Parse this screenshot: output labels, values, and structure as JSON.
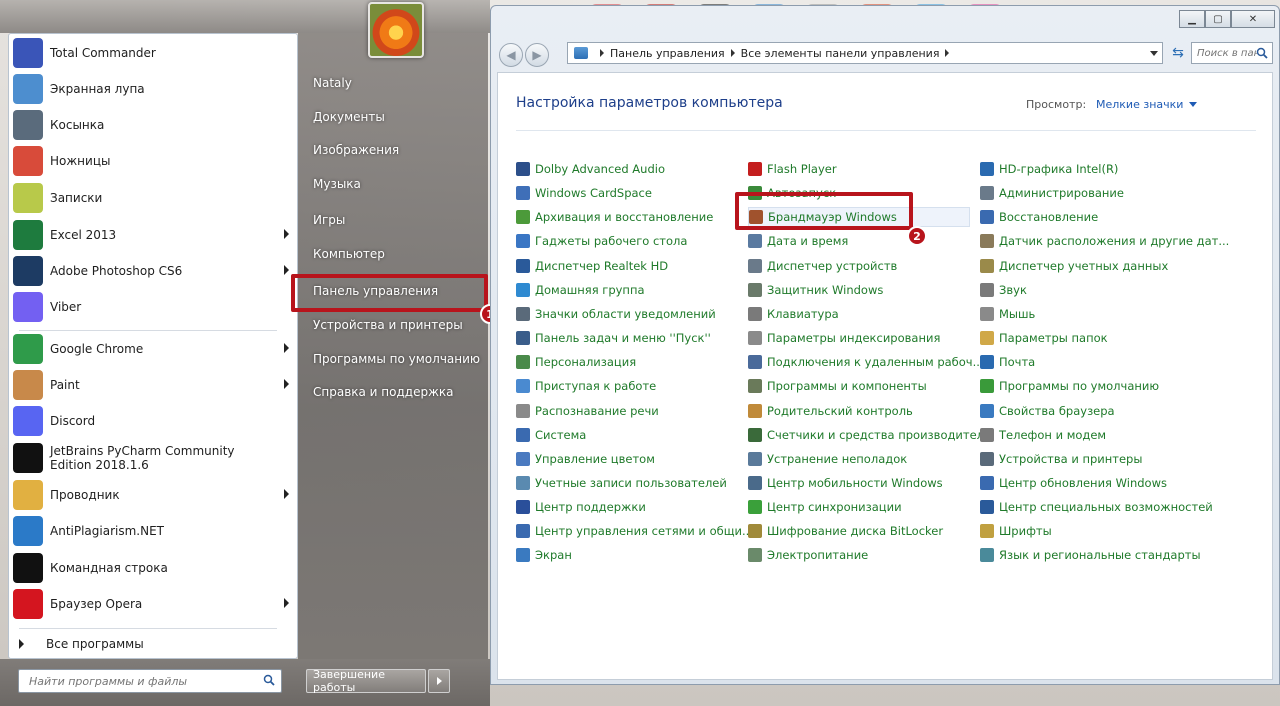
{
  "start_menu": {
    "programs": [
      {
        "label": "Total Commander",
        "icon": "total-commander-icon",
        "color": "#3a55b8",
        "arrow": false
      },
      {
        "label": "Экранная лупа",
        "icon": "magnifier-icon",
        "color": "#4d8ecf",
        "arrow": false
      },
      {
        "label": "Косынка",
        "icon": "solitaire-icon",
        "color": "#5a6b7c",
        "arrow": false
      },
      {
        "label": "Ножницы",
        "icon": "scissors-icon",
        "color": "#d84b3a",
        "arrow": false
      },
      {
        "label": "Записки",
        "icon": "sticky-notes-icon",
        "color": "#b8c94a",
        "arrow": false
      },
      {
        "label": "Excel 2013",
        "icon": "excel-icon",
        "color": "#1e7b3e",
        "arrow": true
      },
      {
        "label": "Adobe Photoshop CS6",
        "icon": "photoshop-icon",
        "color": "#1d3b63",
        "arrow": true
      },
      {
        "label": "Viber",
        "icon": "viber-icon",
        "color": "#7360f2",
        "arrow": false
      },
      {
        "label": "Google Chrome",
        "icon": "chrome-icon",
        "color": "#2f9b4a",
        "arrow": true
      },
      {
        "label": "Paint",
        "icon": "paint-icon",
        "color": "#c8894a",
        "arrow": true
      },
      {
        "label": "Discord",
        "icon": "discord-icon",
        "color": "#5865f2",
        "arrow": false
      },
      {
        "label": "JetBrains PyCharm Community Edition 2018.1.6",
        "icon": "pycharm-icon",
        "color": "#111111",
        "arrow": false
      },
      {
        "label": "Проводник",
        "icon": "explorer-icon",
        "color": "#e1b041",
        "arrow": true
      },
      {
        "label": "AntiPlagiarism.NET",
        "icon": "antiplagiarism-icon",
        "color": "#2b7ac8",
        "arrow": false
      },
      {
        "label": "Командная строка",
        "icon": "cmd-icon",
        "color": "#111111",
        "arrow": false
      },
      {
        "label": "Браузер Opera",
        "icon": "opera-icon",
        "color": "#d4151f",
        "arrow": true
      }
    ],
    "all_programs": "Все программы",
    "search_placeholder": "Найти программы и файлы",
    "right_items": [
      {
        "label": "Nataly",
        "name": "user-name"
      },
      {
        "label": "Документы",
        "name": "documents"
      },
      {
        "label": "Изображения",
        "name": "pictures"
      },
      {
        "label": "Музыка",
        "name": "music"
      },
      {
        "label": "Игры",
        "name": "games"
      },
      {
        "label": "Компьютер",
        "name": "computer"
      },
      {
        "label": "Панель управления",
        "name": "control-panel"
      },
      {
        "label": "Устройства и принтеры",
        "name": "devices-printers"
      },
      {
        "label": "Программы по умолчанию",
        "name": "default-programs"
      },
      {
        "label": "Справка и поддержка",
        "name": "help-support"
      }
    ],
    "shutdown_label": "Завершение работы"
  },
  "annotations": {
    "step1": "1",
    "step2": "2",
    "highlight_color": "#b8141c"
  },
  "control_panel": {
    "breadcrumbs": [
      "Панель управления",
      "Все элементы панели управления"
    ],
    "search_placeholder": "Поиск в панели...",
    "heading": "Настройка параметров компьютера",
    "view_label": "Просмотр:",
    "view_value": "Мелкие значки",
    "columns": [
      [
        {
          "label": "Dolby Advanced Audio",
          "icon": "dolby-icon",
          "color": "#2c4f8a"
        },
        {
          "label": "Windows CardSpace",
          "icon": "cardspace-icon",
          "color": "#3f6fb8"
        },
        {
          "label": "Архивация и восстановление",
          "icon": "backup-icon",
          "color": "#4c9a3a"
        },
        {
          "label": "Гаджеты рабочего стола",
          "icon": "gadgets-icon",
          "color": "#3a76c4"
        },
        {
          "label": "Диспетчер Realtek HD",
          "icon": "realtek-icon",
          "color": "#2a5a9a"
        },
        {
          "label": "Домашняя группа",
          "icon": "homegroup-icon",
          "color": "#2f8ad1"
        },
        {
          "label": "Значки области уведомлений",
          "icon": "notification-icon",
          "color": "#5a6a7a"
        },
        {
          "label": "Панель задач и меню ''Пуск''",
          "icon": "taskbar-icon",
          "color": "#3a5d8a"
        },
        {
          "label": "Персонализация",
          "icon": "personalization-icon",
          "color": "#4a8a4a"
        },
        {
          "label": "Приступая к работе",
          "icon": "getting-started-icon",
          "color": "#4a8ad0"
        },
        {
          "label": "Распознавание речи",
          "icon": "speech-icon",
          "color": "#8a8a8a"
        },
        {
          "label": "Система",
          "icon": "system-icon",
          "color": "#3a6ab0"
        },
        {
          "label": "Управление цветом",
          "icon": "color-mgmt-icon",
          "color": "#4a7ac0"
        },
        {
          "label": "Учетные записи пользователей",
          "icon": "user-accounts-icon",
          "color": "#5a8ab0"
        },
        {
          "label": "Центр поддержки",
          "icon": "action-center-icon",
          "color": "#2a4f9a"
        },
        {
          "label": "Центр управления сетями и общи...",
          "icon": "network-icon",
          "color": "#3a6ab0"
        },
        {
          "label": "Экран",
          "icon": "display-icon",
          "color": "#3a7ac0"
        }
      ],
      [
        {
          "label": "Flash Player",
          "icon": "flash-icon",
          "color": "#c41e1e"
        },
        {
          "label": "Автозапуск",
          "icon": "autoplay-icon",
          "color": "#3a8a3a"
        },
        {
          "label": "Брандмауэр Windows",
          "icon": "firewall-icon",
          "color": "#a0522d"
        },
        {
          "label": "Дата и время",
          "icon": "datetime-icon",
          "color": "#5a7aa0"
        },
        {
          "label": "Диспетчер устройств",
          "icon": "device-manager-icon",
          "color": "#6a7a8a"
        },
        {
          "label": "Защитник Windows",
          "icon": "defender-icon",
          "color": "#6a7a6a"
        },
        {
          "label": "Клавиатура",
          "icon": "keyboard-icon",
          "color": "#7a7a7a"
        },
        {
          "label": "Параметры индексирования",
          "icon": "indexing-icon",
          "color": "#8a8a8a"
        },
        {
          "label": "Подключения к удаленным рабоч...",
          "icon": "remote-desktop-icon",
          "color": "#4a6a9a"
        },
        {
          "label": "Программы и компоненты",
          "icon": "programs-features-icon",
          "color": "#6a7a5a"
        },
        {
          "label": "Родительский контроль",
          "icon": "parental-control-icon",
          "color": "#c08a3a"
        },
        {
          "label": "Счетчики и средства производител...",
          "icon": "performance-icon",
          "color": "#3a6a3a"
        },
        {
          "label": "Устранение неполадок",
          "icon": "troubleshooting-icon",
          "color": "#5a7a9a"
        },
        {
          "label": "Центр мобильности Windows",
          "icon": "mobility-icon",
          "color": "#4a6a8a"
        },
        {
          "label": "Центр синхронизации",
          "icon": "sync-icon",
          "color": "#3aa03a"
        },
        {
          "label": "Шифрование диска BitLocker",
          "icon": "bitlocker-icon",
          "color": "#a08a3a"
        },
        {
          "label": "Электропитание",
          "icon": "power-icon",
          "color": "#6a8a6a"
        }
      ],
      [
        {
          "label": "HD-графика Intel(R)",
          "icon": "intel-graphics-icon",
          "color": "#2a6ab0"
        },
        {
          "label": "Администрирование",
          "icon": "admin-tools-icon",
          "color": "#6a7a8a"
        },
        {
          "label": "Восстановление",
          "icon": "recovery-icon",
          "color": "#3a6ab0"
        },
        {
          "label": "Датчик расположения и другие дат...",
          "icon": "location-sensor-icon",
          "color": "#8a7a5a"
        },
        {
          "label": "Диспетчер учетных данных",
          "icon": "credential-manager-icon",
          "color": "#9a8a4a"
        },
        {
          "label": "Звук",
          "icon": "sound-icon",
          "color": "#7a7a7a"
        },
        {
          "label": "Мышь",
          "icon": "mouse-icon",
          "color": "#8a8a8a"
        },
        {
          "label": "Параметры папок",
          "icon": "folder-options-icon",
          "color": "#d0a848"
        },
        {
          "label": "Почта",
          "icon": "mail-icon",
          "color": "#2a6ab0"
        },
        {
          "label": "Программы по умолчанию",
          "icon": "default-programs-icon",
          "color": "#3a9a3a"
        },
        {
          "label": "Свойства браузера",
          "icon": "internet-options-icon",
          "color": "#3a7ac0"
        },
        {
          "label": "Телефон и модем",
          "icon": "phone-modem-icon",
          "color": "#7a7a7a"
        },
        {
          "label": "Устройства и принтеры",
          "icon": "devices-printers-icon",
          "color": "#5a6a7a"
        },
        {
          "label": "Центр обновления Windows",
          "icon": "windows-update-icon",
          "color": "#3a6ab0"
        },
        {
          "label": "Центр специальных возможностей",
          "icon": "ease-access-icon",
          "color": "#2a5a9a"
        },
        {
          "label": "Шрифты",
          "icon": "fonts-icon",
          "color": "#c0a040"
        },
        {
          "label": "Язык и региональные стандарты",
          "icon": "region-icon",
          "color": "#4a8a9a"
        }
      ]
    ]
  }
}
